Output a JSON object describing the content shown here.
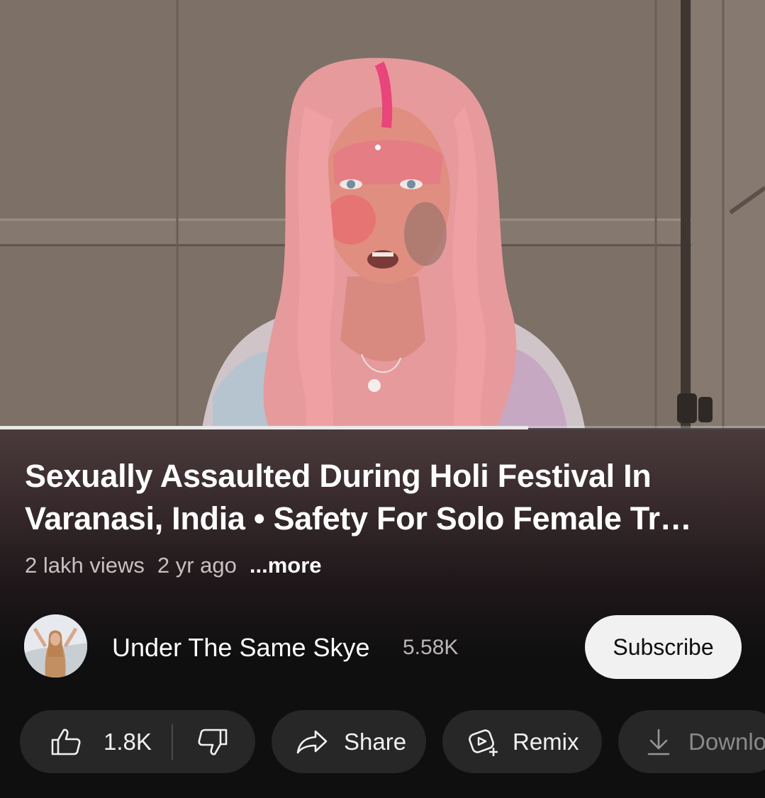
{
  "video": {
    "progress_fraction": 0.69
  },
  "title": "Sexually Assaulted During Holi Festival In Varanasi, India • Safety For Solo Female Tr…",
  "meta": {
    "views": "2 lakh views",
    "age": "2 yr ago",
    "more": "...more"
  },
  "channel": {
    "name": "Under The Same Skye",
    "subscribers": "5.58K",
    "subscribe_label": "Subscribe"
  },
  "actions": {
    "like_count": "1.8K",
    "share_label": "Share",
    "remix_label": "Remix",
    "download_label": "Downlo"
  },
  "icons": {
    "like": "thumbs-up-icon",
    "dislike": "thumbs-down-icon",
    "share": "share-arrow-icon",
    "remix": "remix-icon",
    "download": "download-icon"
  },
  "colors": {
    "background": "#0f0f0f",
    "pill": "#272727",
    "subscribe_bg": "#f1f1f1"
  }
}
